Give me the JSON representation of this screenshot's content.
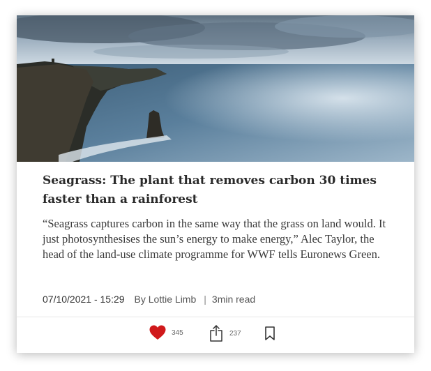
{
  "article": {
    "image_alt": "Sea cliffs above the ocean",
    "title": "Seagrass: The plant that removes carbon 30 times faster than a rainforest",
    "excerpt": "“Seagrass captures carbon in the same way that the grass on land would. It just photosynthesises the sun’s energy to make energy,” Alec Taylor, the head of the land-use climate programme for WWF tells Euronews Green.",
    "date": "07/10/2021 - 15:29",
    "author": "By Lottie Limb",
    "separator": "|",
    "read_time": "3min read"
  },
  "actions": {
    "likes": "345",
    "shares": "237",
    "icons": [
      "heart-icon",
      "share-icon",
      "bookmark-icon"
    ]
  },
  "colors": {
    "heart": "#d0191b",
    "title": "#2a2a2a",
    "body": "#3a3a3a",
    "meta": "#555555"
  }
}
